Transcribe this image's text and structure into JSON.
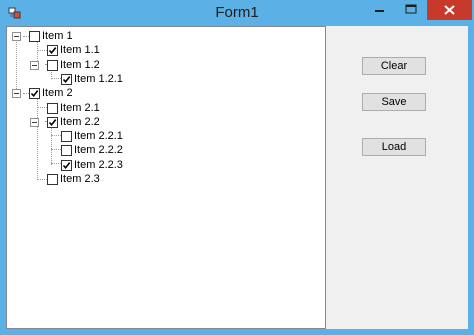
{
  "window": {
    "title": "Form1",
    "colors": {
      "titlebar": "#5bb0e6",
      "close": "#c7392b"
    }
  },
  "titlebar_controls": {
    "minimize_icon": "minimize-icon",
    "maximize_icon": "maximize-icon",
    "close_icon": "close-icon"
  },
  "tree": {
    "nodes": [
      {
        "label": "Item 1",
        "checked": false,
        "expanded": true,
        "depth": 0
      },
      {
        "label": "Item 1.1",
        "checked": true,
        "depth": 1
      },
      {
        "label": "Item 1.2",
        "checked": false,
        "expanded": true,
        "depth": 1
      },
      {
        "label": "Item 1.2.1",
        "checked": true,
        "depth": 2
      },
      {
        "label": "Item 2",
        "checked": true,
        "expanded": true,
        "depth": 0
      },
      {
        "label": "Item 2.1",
        "checked": false,
        "depth": 1
      },
      {
        "label": "Item 2.2",
        "checked": true,
        "expanded": true,
        "depth": 1
      },
      {
        "label": "Item 2.2.1",
        "checked": false,
        "depth": 2
      },
      {
        "label": "Item 2.2.2",
        "checked": false,
        "depth": 2
      },
      {
        "label": "Item 2.2.3",
        "checked": true,
        "depth": 2
      },
      {
        "label": "Item 2.3",
        "checked": false,
        "depth": 1
      }
    ]
  },
  "buttons": {
    "clear_label": "Clear",
    "save_label": "Save",
    "load_label": "Load"
  }
}
